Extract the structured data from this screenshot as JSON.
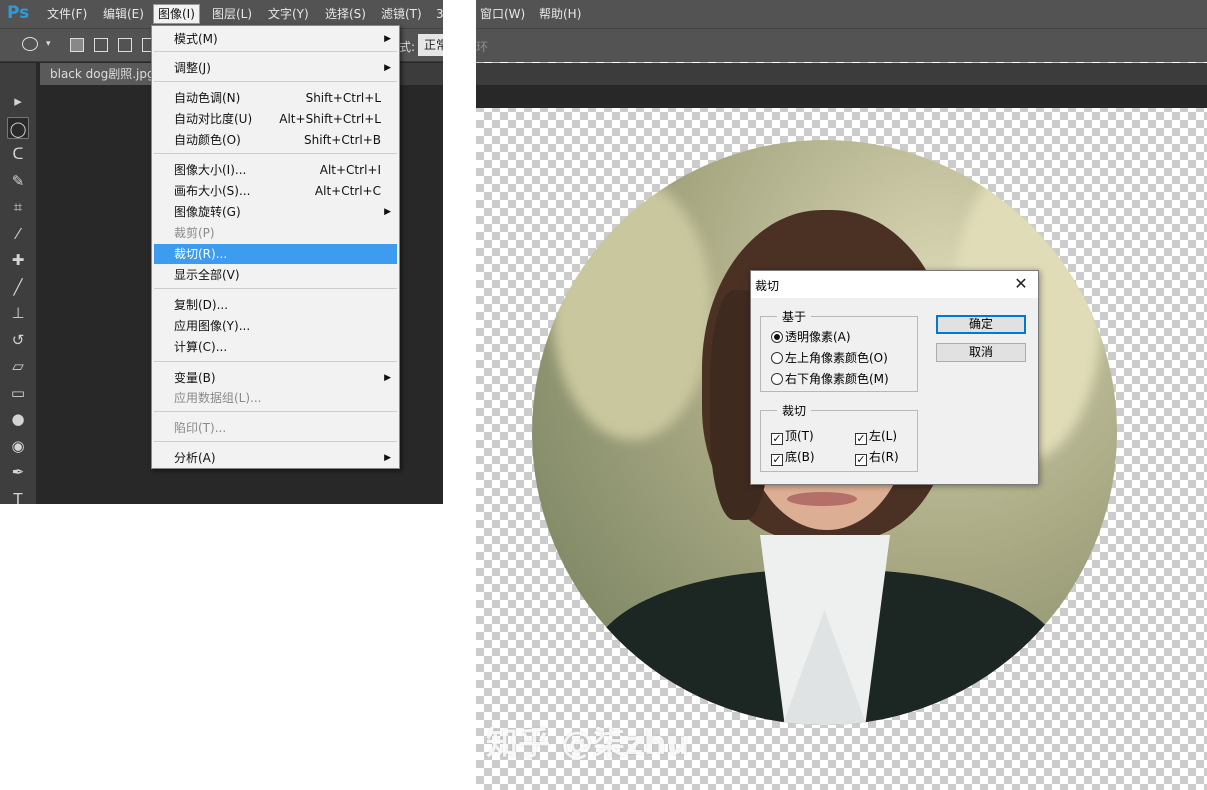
{
  "app": {
    "logo": "Ps"
  },
  "menubar": {
    "items": [
      {
        "label": "文件(F)"
      },
      {
        "label": "编辑(E)"
      },
      {
        "label": "图像(I)"
      },
      {
        "label": "图层(L)"
      },
      {
        "label": "文字(Y)"
      },
      {
        "label": "选择(S)"
      },
      {
        "label": "滤镜(T)"
      },
      {
        "label": "3"
      },
      {
        "label": "窗口(W)"
      },
      {
        "label": "帮助(H)"
      }
    ]
  },
  "options_bar": {
    "mode_label": "式:",
    "mode_value": "正常",
    "right_fragment": "环"
  },
  "document_tab": {
    "label": "black dog剧照.jpg"
  },
  "image_menu": {
    "items": [
      {
        "label": "模式(M)",
        "shortcut": "",
        "submenu": true,
        "disabled": false
      },
      {
        "label": "调整(J)",
        "shortcut": "",
        "submenu": true,
        "disabled": false
      },
      {
        "label": "自动色调(N)",
        "shortcut": "Shift+Ctrl+L",
        "submenu": false,
        "disabled": false
      },
      {
        "label": "自动对比度(U)",
        "shortcut": "Alt+Shift+Ctrl+L",
        "submenu": false,
        "disabled": false
      },
      {
        "label": "自动颜色(O)",
        "shortcut": "Shift+Ctrl+B",
        "submenu": false,
        "disabled": false
      },
      {
        "label": "图像大小(I)...",
        "shortcut": "Alt+Ctrl+I",
        "submenu": false,
        "disabled": false
      },
      {
        "label": "画布大小(S)...",
        "shortcut": "Alt+Ctrl+C",
        "submenu": false,
        "disabled": false
      },
      {
        "label": "图像旋转(G)",
        "shortcut": "",
        "submenu": true,
        "disabled": false
      },
      {
        "label": "裁剪(P)",
        "shortcut": "",
        "submenu": false,
        "disabled": true
      },
      {
        "label": "裁切(R)...",
        "shortcut": "",
        "submenu": false,
        "disabled": false,
        "highlighted": true
      },
      {
        "label": "显示全部(V)",
        "shortcut": "",
        "submenu": false,
        "disabled": false
      },
      {
        "label": "复制(D)...",
        "shortcut": "",
        "submenu": false,
        "disabled": false
      },
      {
        "label": "应用图像(Y)...",
        "shortcut": "",
        "submenu": false,
        "disabled": false
      },
      {
        "label": "计算(C)...",
        "shortcut": "",
        "submenu": false,
        "disabled": false
      },
      {
        "label": "变量(B)",
        "shortcut": "",
        "submenu": true,
        "disabled": false
      },
      {
        "label": "应用数据组(L)...",
        "shortcut": "",
        "submenu": false,
        "disabled": true
      },
      {
        "label": "陷印(T)...",
        "shortcut": "",
        "submenu": false,
        "disabled": true
      },
      {
        "label": "分析(A)",
        "shortcut": "",
        "submenu": true,
        "disabled": false
      }
    ]
  },
  "tools": [
    {
      "icon": "move-tool-icon",
      "glyph": "▸"
    },
    {
      "icon": "elliptical-marquee-tool-icon",
      "glyph": "◯"
    },
    {
      "icon": "lasso-tool-icon",
      "glyph": "ᑕ"
    },
    {
      "icon": "quick-selection-tool-icon",
      "glyph": "✎"
    },
    {
      "icon": "crop-tool-icon",
      "glyph": "⌗"
    },
    {
      "icon": "eyedropper-tool-icon",
      "glyph": "⁄"
    },
    {
      "icon": "healing-brush-tool-icon",
      "glyph": "✚"
    },
    {
      "icon": "brush-tool-icon",
      "glyph": "╱"
    },
    {
      "icon": "clone-stamp-tool-icon",
      "glyph": "⊥"
    },
    {
      "icon": "history-brush-tool-icon",
      "glyph": "↺"
    },
    {
      "icon": "eraser-tool-icon",
      "glyph": "▱"
    },
    {
      "icon": "gradient-tool-icon",
      "glyph": "▭"
    },
    {
      "icon": "blur-tool-icon",
      "glyph": "●"
    },
    {
      "icon": "dodge-tool-icon",
      "glyph": "◉"
    },
    {
      "icon": "pen-tool-icon",
      "glyph": "✒"
    },
    {
      "icon": "type-tool-icon",
      "glyph": "T"
    }
  ],
  "trim_dialog": {
    "title": "裁切",
    "based_on": {
      "legend": "基于",
      "options": [
        {
          "label": "透明像素(A)",
          "checked": true
        },
        {
          "label": "左上角像素颜色(O)",
          "checked": false
        },
        {
          "label": "右下角像素颜色(M)",
          "checked": false
        }
      ]
    },
    "trim_away": {
      "legend": "裁切",
      "options": [
        {
          "label": "顶(T)",
          "checked": true
        },
        {
          "label": "左(L)",
          "checked": true
        },
        {
          "label": "底(B)",
          "checked": true
        },
        {
          "label": "右(R)",
          "checked": true
        }
      ]
    },
    "ok_label": "确定",
    "cancel_label": "取消"
  },
  "watermark": "知乎 @柒zhu",
  "colors": {
    "highlight": "#3d9bf0",
    "ps_blue": "#2e9bd8",
    "ui_gray": "#535353"
  }
}
